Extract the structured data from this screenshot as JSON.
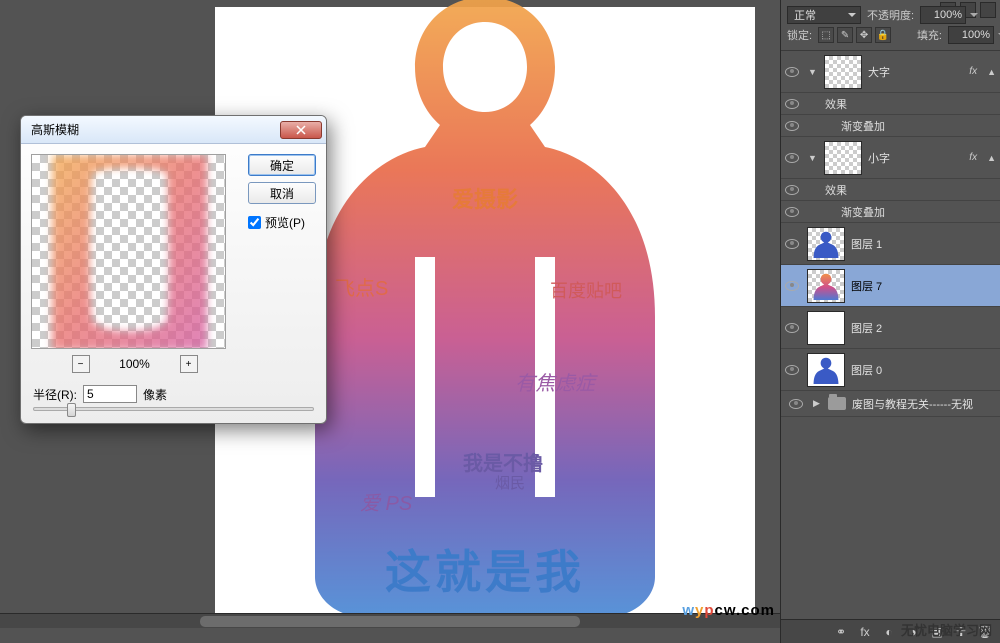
{
  "canvas": {
    "main_text": "这就是我",
    "t1": "爱摄影",
    "t2": "百度贴吧",
    "t3": "有焦虑症",
    "t4": "我是不撸",
    "t5": "烟民",
    "t6": "爱 PS",
    "t7": "飞点S"
  },
  "dialog": {
    "title": "高斯模糊",
    "ok": "确定",
    "cancel": "取消",
    "preview_label": "预览(P)",
    "preview_checked": true,
    "zoom": "100%",
    "radius_label": "半径(R):",
    "radius_value": "5",
    "radius_unit": "像素"
  },
  "panel": {
    "blend_mode": "正常",
    "opacity_label": "不透明度:",
    "opacity_value": "100%",
    "lock_label": "锁定:",
    "fill_label": "填充:",
    "fill_value": "100%",
    "layers": {
      "l0": "大字",
      "l0_fx": "效果",
      "l0_fx1": "渐变叠加",
      "l1": "小字",
      "l1_fx": "效果",
      "l1_fx1": "渐变叠加",
      "l2": "图层 1",
      "l3": "图层 7",
      "l4": "图层 2",
      "l5": "图层 0",
      "group": "废图与教程无关------无视"
    },
    "fx_badge": "fx"
  },
  "watermark": "无忧电脑学习网",
  "watermark2": "wypcw.com"
}
